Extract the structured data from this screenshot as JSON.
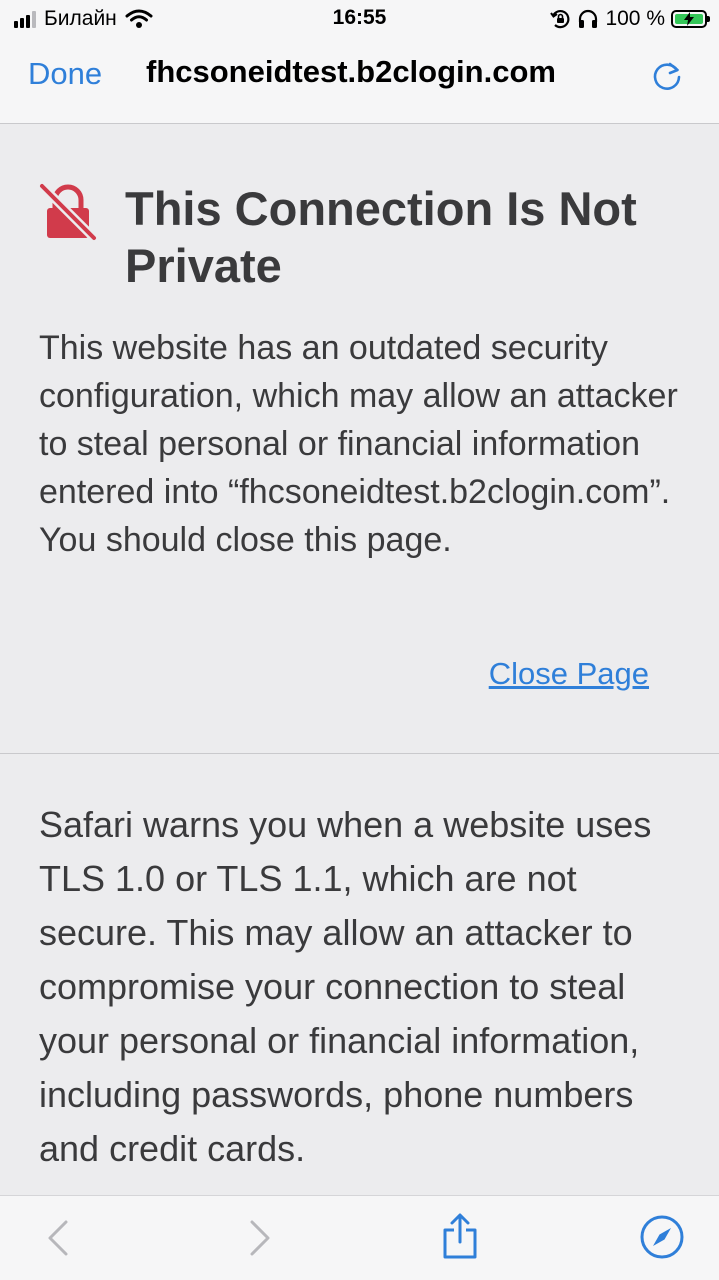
{
  "status_bar": {
    "carrier": "Билайн",
    "time": "16:55",
    "battery": "100 %",
    "icons": [
      "cellular-signal-icon",
      "wifi-icon",
      "orientation-lock-icon",
      "headphones-icon",
      "battery-charging-icon"
    ]
  },
  "nav": {
    "done_label": "Done",
    "title": "fhcsoneidtest.b2clogin.com",
    "reload_icon": "reload-icon"
  },
  "warning": {
    "icon": "insecure-lock-icon",
    "title": "This Connection Is Not Private",
    "body": "This website has an outdated security configuration, which may allow an attacker to steal personal or financial information entered into “fhcsoneidtest.b2clogin.com”. You should close this page.",
    "close_label": "Close Page"
  },
  "details": {
    "text": "Safari warns you when a website uses TLS 1.0 or TLS 1.1, which are not secure. This may allow an attacker to compromise your connection to steal your personal or financial information, including passwords, phone numbers and credit cards."
  },
  "toolbar": {
    "icons": [
      "back-icon",
      "forward-icon",
      "share-icon",
      "compass-icon"
    ]
  },
  "colors": {
    "accent": "#2f7fd9",
    "danger": "#d13b4b",
    "text": "#3a3a3c",
    "background": "#ececee",
    "battery_fill": "#34c759"
  }
}
